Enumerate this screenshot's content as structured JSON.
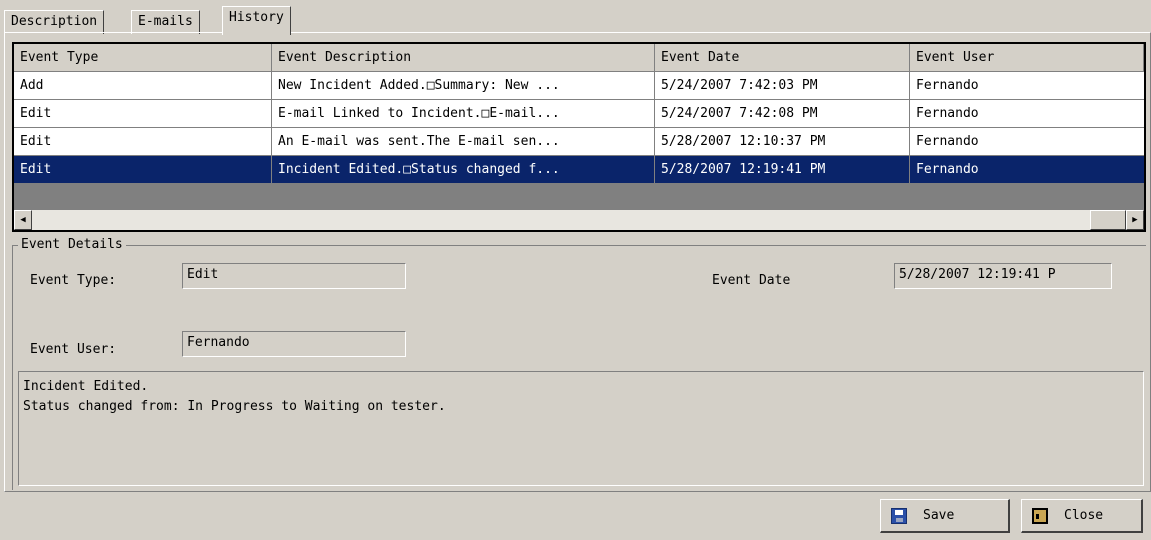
{
  "tabs": [
    "Description",
    "E-mails",
    "History"
  ],
  "active_tab": "History",
  "grid": {
    "columns": [
      "Event Type",
      "Event Description",
      "Event Date",
      "Event User"
    ],
    "rows": [
      {
        "type": "Add",
        "description": "New Incident Added.□Summary: New ...",
        "date": "5/24/2007 7:42:03 PM",
        "user": "Fernando"
      },
      {
        "type": "Edit",
        "description": "E-mail Linked to Incident.□E-mail...",
        "date": "5/24/2007 7:42:08 PM",
        "user": "Fernando"
      },
      {
        "type": "Edit",
        "description": "An E-mail was sent.The E-mail sen...",
        "date": "5/28/2007 12:10:37 PM",
        "user": "Fernando"
      },
      {
        "type": "Edit",
        "description": "Incident Edited.□Status changed f...",
        "date": "5/28/2007 12:19:41 PM",
        "user": "Fernando"
      }
    ],
    "selected_row": 3
  },
  "details": {
    "legend": "Event Details",
    "event_type_label": "Event Type:",
    "event_type_value": "Edit",
    "event_date_label": "Event Date",
    "event_date_value": "5/28/2007 12:19:41 P",
    "event_user_label": "Event User:",
    "event_user_value": "Fernando",
    "description_text": "Incident Edited.\nStatus changed from: In Progress to Waiting on tester."
  },
  "buttons": {
    "save_label": "Save",
    "close_label": "Close"
  },
  "icons": {
    "save": "floppy-disk-icon",
    "close": "door-exit-icon",
    "scroll_left": "arrow-left-icon",
    "scroll_right": "arrow-right-icon"
  },
  "colors": {
    "selection": "#0a246a",
    "window_bg": "#d4d0c8"
  }
}
